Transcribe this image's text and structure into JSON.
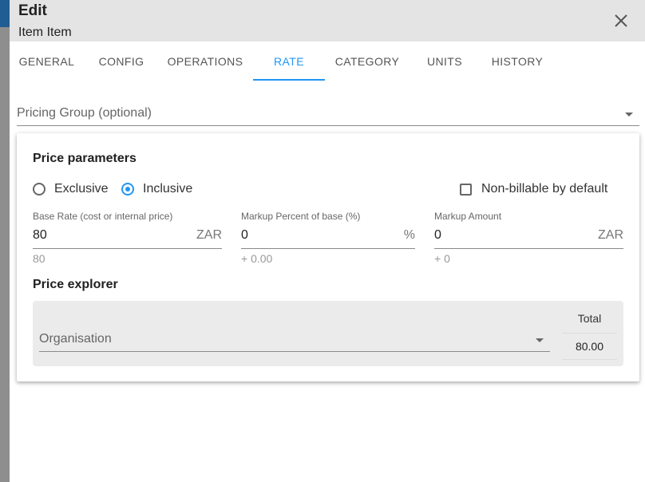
{
  "dialog": {
    "title": "Edit",
    "subtitle": "Item Item",
    "close_icon": "close-icon"
  },
  "tabs": [
    {
      "label": "GENERAL",
      "active": false
    },
    {
      "label": "CONFIG",
      "active": false
    },
    {
      "label": "OPERATIONS",
      "active": false
    },
    {
      "label": "RATE",
      "active": true
    },
    {
      "label": "CATEGORY",
      "active": false
    },
    {
      "label": "UNITS",
      "active": false
    },
    {
      "label": "HISTORY",
      "active": false
    }
  ],
  "pricing_group": {
    "label": "Pricing Group (optional)",
    "icon": "chevron-down-icon"
  },
  "price_parameters": {
    "title": "Price parameters",
    "tax_mode": {
      "options": [
        "Exclusive",
        "Inclusive"
      ],
      "selected": "Inclusive"
    },
    "non_billable": {
      "label": "Non-billable by default",
      "checked": false
    },
    "base_rate": {
      "label": "Base Rate (cost or internal price)",
      "value": "80",
      "suffix": "ZAR",
      "hint": "80"
    },
    "markup_percent": {
      "label": "Markup Percent of base (%)",
      "value": "0",
      "suffix": "%",
      "hint": "+ 0.00"
    },
    "markup_amount": {
      "label": "Markup Amount",
      "value": "0",
      "suffix": "ZAR",
      "hint": "+ 0"
    }
  },
  "price_explorer": {
    "title": "Price explorer",
    "organisation_label": "Organisation",
    "total_header": "Total",
    "total_value": "80.00"
  },
  "colors": {
    "accent": "#2196f3",
    "header_bg": "#e4e4e4",
    "explorer_bg": "#ebebeb"
  }
}
